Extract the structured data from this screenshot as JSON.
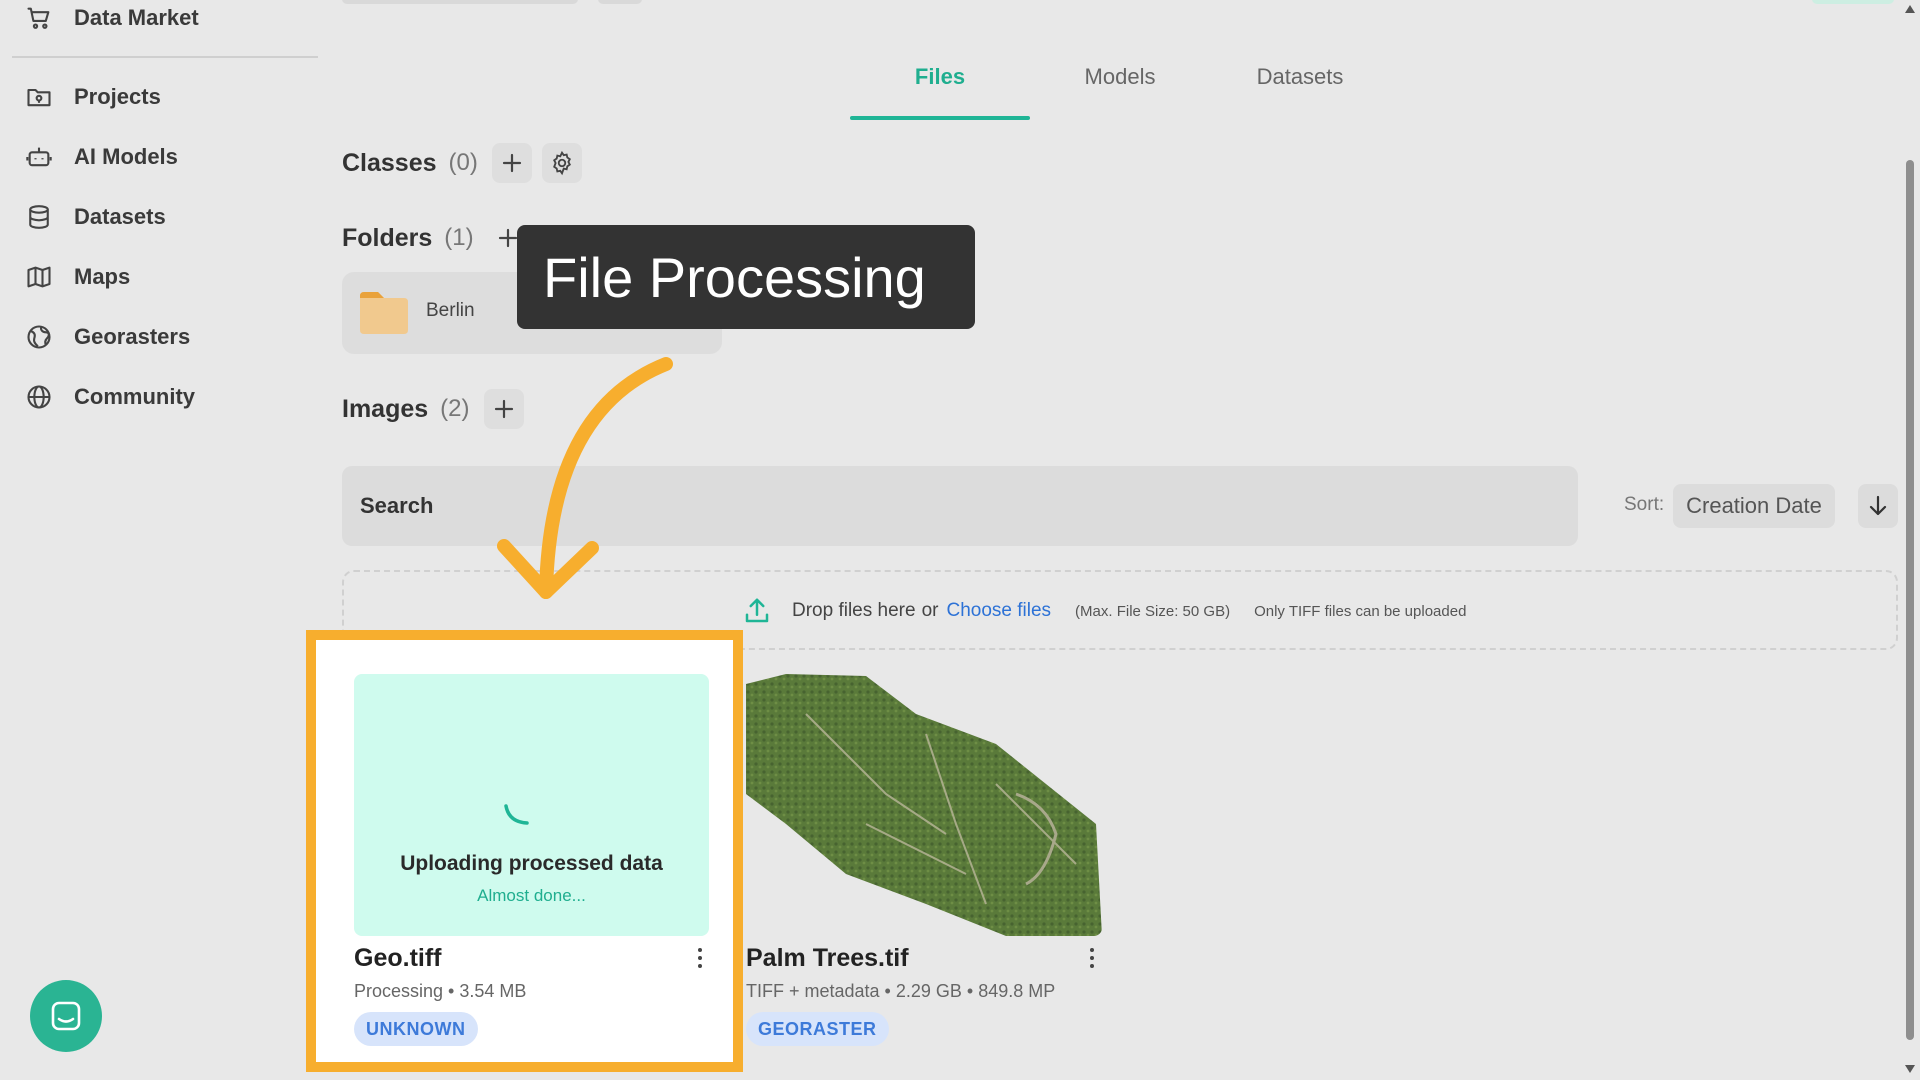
{
  "sidebar": {
    "top_item": "Data Market",
    "items": [
      {
        "label": "Projects",
        "icon": "folder-icon"
      },
      {
        "label": "AI Models",
        "icon": "robot-icon"
      },
      {
        "label": "Datasets",
        "icon": "database-icon"
      },
      {
        "label": "Maps",
        "icon": "map-icon"
      },
      {
        "label": "Georasters",
        "icon": "globe-grid-icon"
      },
      {
        "label": "Community",
        "icon": "globe-icon"
      }
    ]
  },
  "tabs": [
    {
      "label": "Files",
      "active": true
    },
    {
      "label": "Models",
      "active": false
    },
    {
      "label": "Datasets",
      "active": false
    }
  ],
  "classes": {
    "title": "Classes",
    "count": "(0)"
  },
  "folders": {
    "title": "Folders",
    "count": "(1)",
    "items": [
      {
        "name": "Berlin"
      }
    ]
  },
  "tooltip": {
    "text": "File Processing"
  },
  "images": {
    "title": "Images",
    "count": "(2)"
  },
  "search": {
    "placeholder": "Search"
  },
  "sort": {
    "label": "Sort:",
    "value": "Creation Date"
  },
  "dropzone": {
    "drop_text": "Drop files here",
    "or_text": "or",
    "choose_text": "Choose files",
    "max_size": "(Max. File Size: 50 GB)",
    "only_tiff": "Only TIFF files can be uploaded"
  },
  "files": [
    {
      "name": "Geo.tiff",
      "meta": "Processing • 3.54 MB",
      "badge": "UNKNOWN",
      "status_title": "Uploading processed data",
      "status_sub": "Almost done..."
    },
    {
      "name": "Palm Trees.tif",
      "meta": "TIFF + metadata • 2.29 GB • 849.8 MP",
      "badge": "GEORASTER"
    }
  ],
  "colors": {
    "accent": "#1fb596",
    "highlight": "#f7ae2e",
    "tooltip_bg": "#333333",
    "badge_bg": "#d7e4fb",
    "badge_text": "#3d7ad9",
    "link": "#2d72d6"
  }
}
